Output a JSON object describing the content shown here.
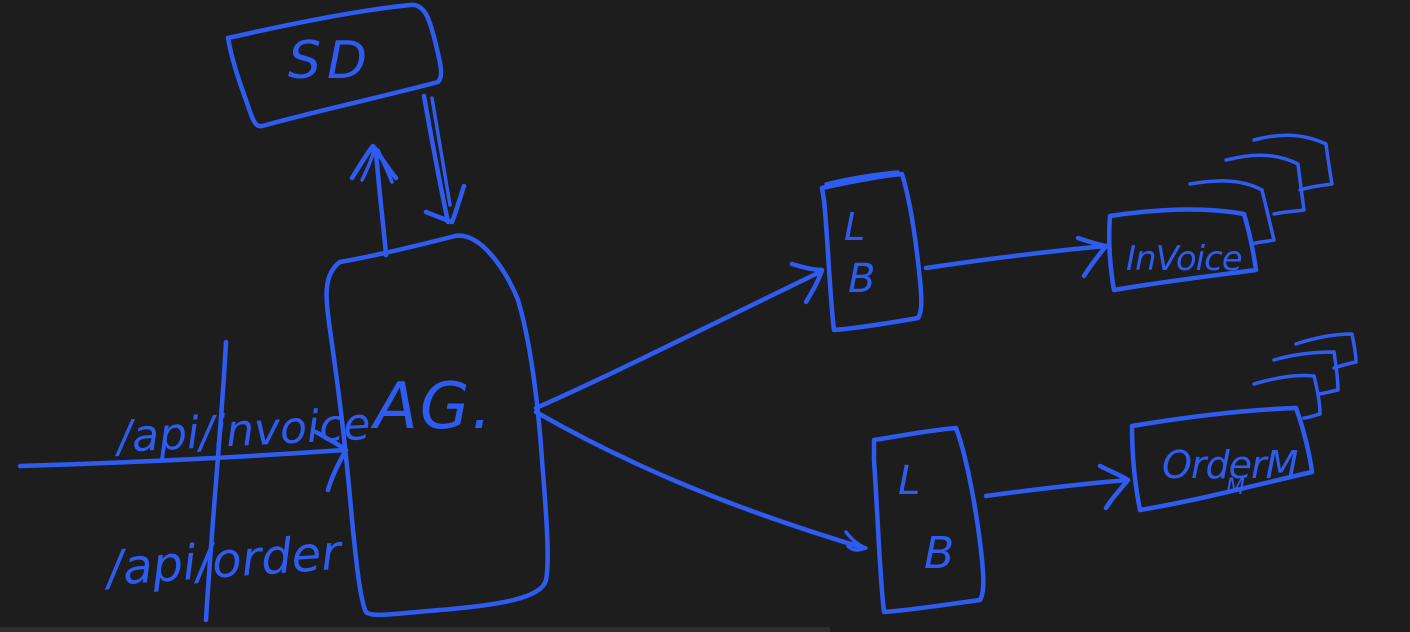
{
  "diagram": {
    "background_color": "#1d1d1d",
    "ink_color": "#2f5cf0",
    "nodes": {
      "service_discovery": {
        "label": "SD"
      },
      "api_gateway": {
        "label": "AG."
      },
      "load_balancer_top": {
        "label_line1": "L",
        "label_line2": "B"
      },
      "load_balancer_bottom": {
        "label_line1": "L",
        "label_line2": "B"
      },
      "invoice_service": {
        "label": "InVoice"
      },
      "order_service": {
        "label_line1": "OrderM",
        "label_line2": "M"
      }
    },
    "routes": {
      "invoice_route": "/api/invoice",
      "order_route": "/api/order"
    }
  }
}
